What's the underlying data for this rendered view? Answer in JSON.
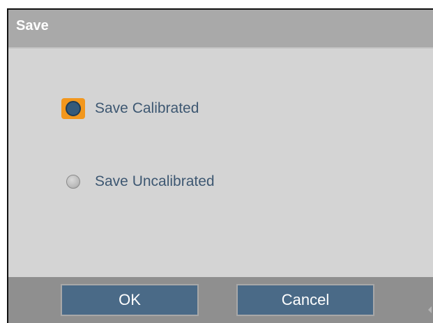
{
  "dialog": {
    "title": "Save"
  },
  "options": [
    {
      "label": "Save Calibrated",
      "selected": true,
      "focused": true
    },
    {
      "label": "Save Uncalibrated",
      "selected": false,
      "focused": false
    }
  ],
  "buttons": {
    "ok_label": "OK",
    "cancel_label": "Cancel"
  },
  "colors": {
    "titlebar": "#a9a9a9",
    "body": "#d4d4d4",
    "footer": "#8f8f8f",
    "button": "#4a6a87",
    "focus_ring": "#f2971d",
    "radio_checked": "#355a7a",
    "label_text": "#3e5872"
  }
}
